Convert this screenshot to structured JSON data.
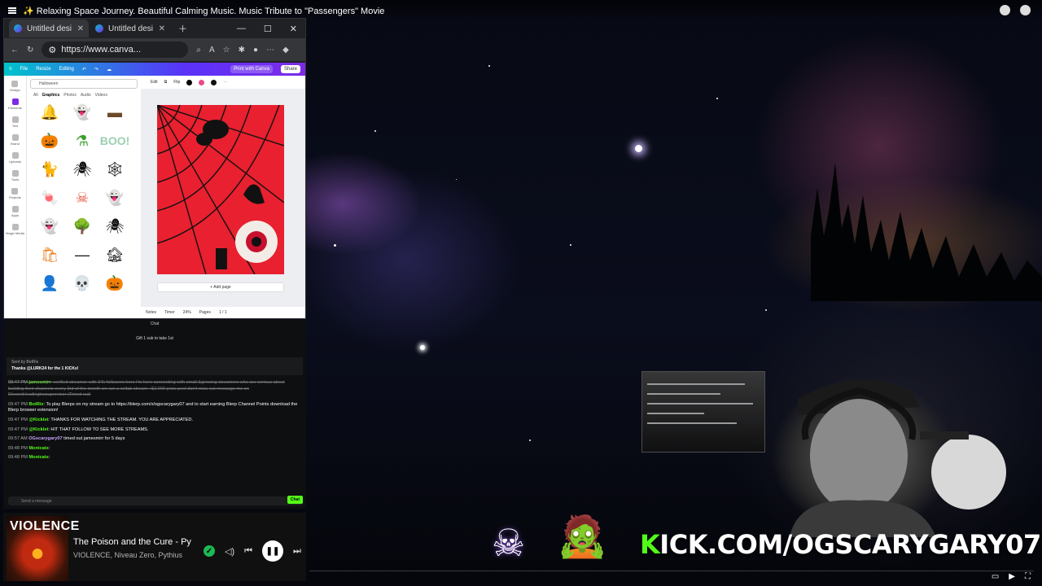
{
  "video": {
    "title": "✨ Relaxing Space Journey. Beautiful Calming Music. Music Tribute to \"Passengers\" Movie"
  },
  "browser": {
    "tabs": [
      {
        "label": "Untitled desi"
      },
      {
        "label": "Untitled desi"
      }
    ],
    "url": "https://www.canva..."
  },
  "canva": {
    "menu": {
      "file": "File",
      "resize": "Resize",
      "editing": "Editing",
      "print": "Print with Canva",
      "share": "Share"
    },
    "rail": [
      "Design",
      "Elements",
      "Text",
      "Brand",
      "Uploads",
      "Tools",
      "Projects",
      "Apps",
      "Magic Media"
    ],
    "search_value": "Halloween",
    "category_tabs": [
      "All",
      "Graphics",
      "Photos",
      "Audio",
      "Videos"
    ],
    "toolbar": {
      "edit": "Edit",
      "flip": "Flip"
    },
    "add_page": "+ Add page",
    "status": {
      "notes": "Notes",
      "timer": "Timer",
      "zoom": "24%",
      "pages": "Pages",
      "page_count": "1 / 1"
    },
    "sticker_text": "BOO!"
  },
  "chat": {
    "title": "Chat",
    "goal": "Gift 1 sub to take 1st",
    "pinned_by": "Sent by BotRix",
    "pinned_text": "Thanks @LURK24 for the 1 KICKs!",
    "messages": [
      {
        "time": "09:47 PM",
        "user": "jamesmirr",
        "text": ": verified streamer with 34k followers here I'm here connecting with small &growing streamers who are serious about building their channels every 3rd of the month we run a collab stream +$2,000 prize pool don't miss out message me on Discord:leadingloxsupervisor (Timed out)",
        "deleted": true
      },
      {
        "time": "09:47 PM",
        "user": "BotRix",
        "text": ": To play Blerps on my stream go to https://blerp.com/x/ogscarygary07 and to start earning Blerp Channel Points download the Blerp browser extension!",
        "deleted": false
      },
      {
        "time": "09:47 PM",
        "user": "@Kicklet",
        "text": ": THANKS FOR WATCHING THE STREAM. YOU ARE APPRECIATED.",
        "deleted": false
      },
      {
        "time": "09:47 PM",
        "user": "@Kicklet",
        "text": ": HIT THAT FOLLOW TO SEE MORE STREAMS.",
        "deleted": false
      },
      {
        "time": "09:57 AM",
        "user": "OGscarygary07",
        "text": " timed out jamesmirr for 5 days",
        "deleted": false
      },
      {
        "time": "09:48 PM",
        "user": "Monicats",
        "text": ":",
        "deleted": false
      },
      {
        "time": "09:48 PM",
        "user": "Monicats",
        "text": ":",
        "deleted": false
      }
    ],
    "input_placeholder": "Send a message",
    "send_label": "Chat"
  },
  "player": {
    "album_title": "VIOLENCE",
    "track": "The Poison and the Cure - Pythius",
    "artist": "VIOLENCE, Niveau Zero, Pythius"
  },
  "overlay": {
    "kick_k": "K",
    "kick_rest": "ICK.COM/OGSCARYGARY07"
  },
  "colors": {
    "kick_green": "#53fc18",
    "poster_red": "#e8202f",
    "canva_purple": "#7d2ae8"
  }
}
